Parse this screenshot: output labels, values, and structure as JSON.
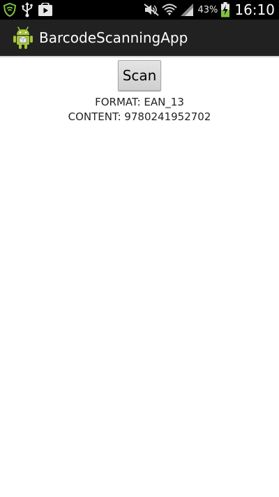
{
  "status_bar": {
    "battery_percent": "43%",
    "time": "16:10",
    "icons": [
      "shield-icon",
      "usb-icon",
      "play-store-icon",
      "mute-icon",
      "wifi-icon",
      "signal-icon",
      "battery-charging-icon"
    ]
  },
  "action_bar": {
    "title": "BarcodeScanningApp",
    "icon": "android-icon"
  },
  "main": {
    "scan_label": "Scan",
    "format_text": "FORMAT: EAN_13",
    "content_text": "CONTENT: 9780241952702"
  },
  "colors": {
    "status_bar_bg": "#000000",
    "action_bar_bg": "#212121",
    "android_green": "#a4c639",
    "wifi_green": "#7fc241"
  }
}
